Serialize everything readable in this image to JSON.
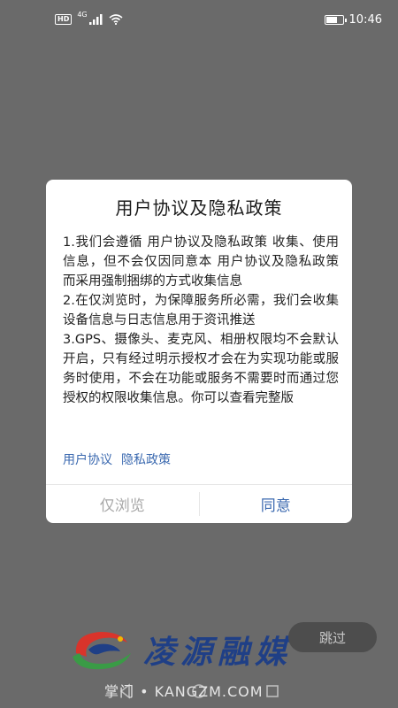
{
  "status_bar": {
    "hd": "HD",
    "network": "4G",
    "time": "10:46",
    "battery_level": 0.75
  },
  "dialog": {
    "title": "用户协议及隐私政策",
    "paragraphs": [
      "1.我们会遵循 用户协议及隐私政策 收集、使用信息，但不会仅因同意本 用户协议及隐私政策 而采用强制捆绑的方式收集信息",
      "2.在仅浏览时，为保障服务所必需，我们会收集设备信息与日志信息用于资讯推送",
      "3.GPS、摄像头、麦克风、相册权限均不会默认开启，只有经过明示授权才会在为实现功能或服务时使用，不会在功能或服务不需要时而通过您授权的权限收集信息。你可以查看完整版"
    ],
    "link_user_agreement": "用户协议",
    "link_privacy_policy": "隐私政策",
    "browse_only_label": "仅浏览",
    "agree_label": "同意"
  },
  "skip_label": "跳过",
  "brand": {
    "name": "凌源融媒"
  },
  "watermark": "掌门 • KANGZM.COM",
  "colors": {
    "overlay": "#6a6a6a",
    "accent": "#3c6ab0",
    "brand_blue": "#1f3f86",
    "brand_red": "#d9342b",
    "brand_green": "#3a9b46",
    "brand_yellow": "#f2b800"
  }
}
